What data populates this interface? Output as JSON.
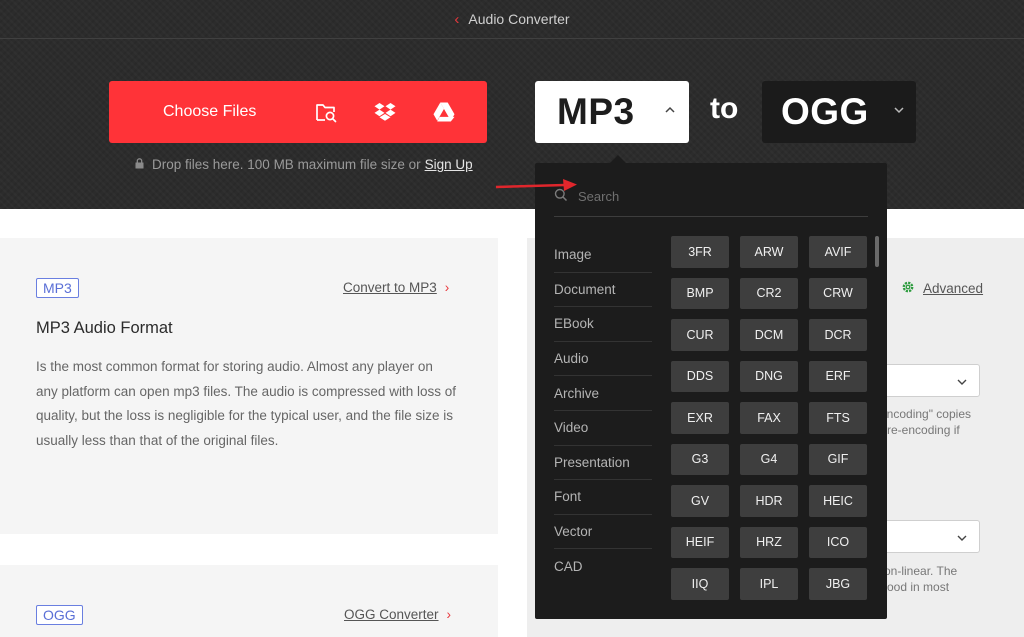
{
  "topbar": {
    "title": "Audio Converter"
  },
  "upload": {
    "choose_label": "Choose Files",
    "drop_note": "Drop files here. 100 MB maximum file size or",
    "signup_label": "Sign Up"
  },
  "conversion": {
    "from": "MP3",
    "to_word": "to",
    "to": "OGG"
  },
  "dropdown": {
    "search_placeholder": "Search",
    "categories": [
      "Image",
      "Document",
      "EBook",
      "Audio",
      "Archive",
      "Video",
      "Presentation",
      "Font",
      "Vector",
      "CAD"
    ],
    "formats": [
      "3FR",
      "ARW",
      "AVIF",
      "BMP",
      "CR2",
      "CRW",
      "CUR",
      "DCM",
      "DCR",
      "DDS",
      "DNG",
      "ERF",
      "EXR",
      "FAX",
      "FTS",
      "G3",
      "G4",
      "GIF",
      "GV",
      "HDR",
      "HEIC",
      "HEIF",
      "HRZ",
      "ICO",
      "IIQ",
      "IPL",
      "JBG"
    ]
  },
  "info_card": {
    "tag": "MP3",
    "link": "Convert to MP3",
    "title": "MP3 Audio Format",
    "description": "Is the most common format for storing audio. Almost any player on any platform can open mp3 files. The audio is compressed with loss of quality, but the loss is negligible for the typical user, and the file size is usually less than that of the original files."
  },
  "info_card2": {
    "tag": "OGG",
    "link": "OGG Converter"
  },
  "settings": {
    "advanced_label": "Advanced",
    "frag1a": "encoding\" copies",
    "frag1b": "re-encoding if",
    "frag2a": "on-linear. The",
    "frag2b": "ood in most"
  },
  "colors": {
    "accent": "#ff3338",
    "hero_bg": "#2c2c2c",
    "dropdown_bg": "#1c1c1c",
    "format_button": "#3e3e3e",
    "tag_blue": "#5a6fd6",
    "advanced_green": "#2e9c3f"
  }
}
